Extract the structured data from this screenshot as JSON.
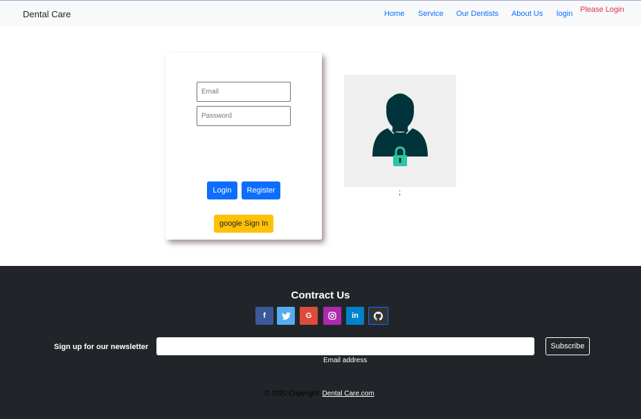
{
  "navbar": {
    "brand": "Dental Care",
    "links": [
      "Home",
      "Service",
      "Our Dentists",
      "About Us",
      "login"
    ],
    "status": "Please Login"
  },
  "login": {
    "email_placeholder": "Email",
    "password_placeholder": "Password",
    "login_label": "Login",
    "register_label": "Register",
    "google_label": "google Sign In"
  },
  "avatar": {
    "icon": "user-lock-icon",
    "caption": ";"
  },
  "footer": {
    "contact_title": "Contract Us",
    "social": [
      {
        "icon": "facebook-icon",
        "glyph": "f",
        "color": "#3b5998"
      },
      {
        "icon": "twitter-icon",
        "glyph": "t",
        "color": "#55acee"
      },
      {
        "icon": "google-icon",
        "glyph": "G",
        "color": "#dd4b39"
      },
      {
        "icon": "instagram-icon",
        "glyph": "◎",
        "color": "#ac2bac"
      },
      {
        "icon": "linkedin-icon",
        "glyph": "in",
        "color": "#0082ca"
      },
      {
        "icon": "github-icon",
        "glyph": "●",
        "color": "#333333"
      }
    ],
    "newsletter_label": "Sign up for our newsletter",
    "email_caption": "Email address",
    "subscribe_label": "Subscribe",
    "copyright_prefix": "© 2020 Copyright:",
    "copyright_link": "Dental Care.com"
  }
}
